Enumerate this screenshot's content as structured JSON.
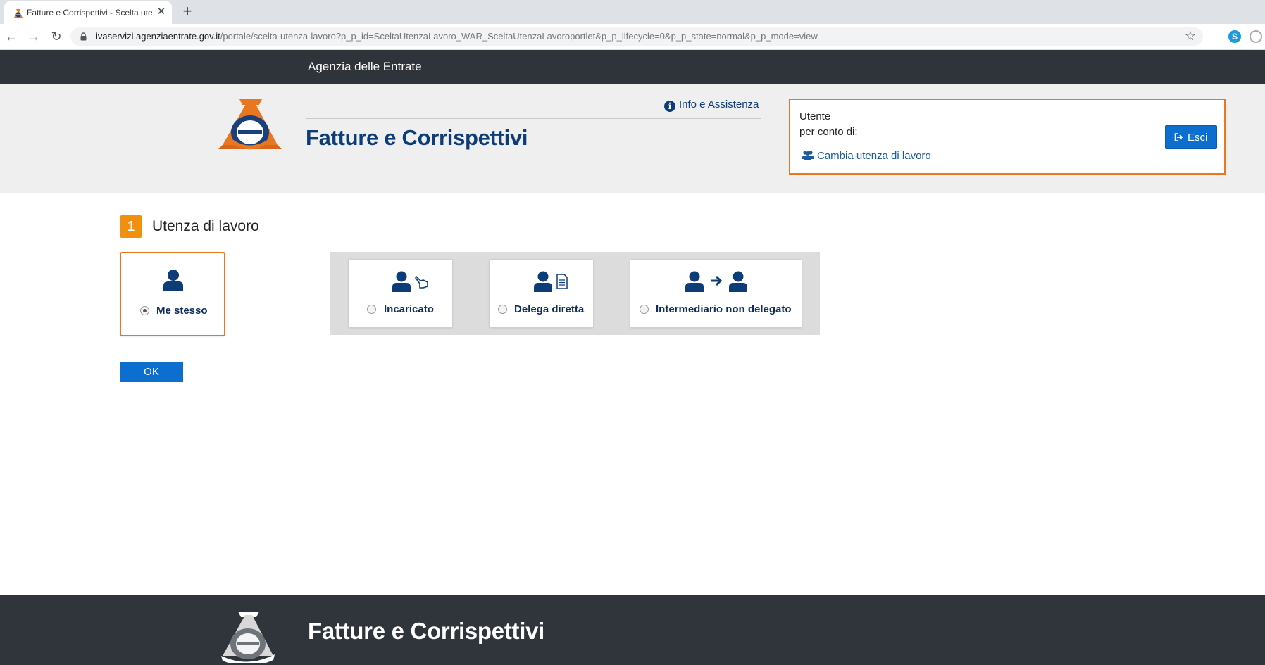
{
  "browser": {
    "tab_title": "Fatture e Corrispettivi - Scelta ute",
    "url_host": "ivaservizi.agenziaentrate.gov.it",
    "url_path": "/portale/scelta-utenza-lavoro?p_p_id=SceltaUtenzaLavoro_WAR_SceltaUtenzaLavoroportlet&p_p_lifecycle=0&p_p_state=normal&p_p_mode=view"
  },
  "site": {
    "agency_name": "Agenzia delle Entrate",
    "app_title": "Fatture e Corrispettivi",
    "info_link": "Info e Assistenza"
  },
  "user_box": {
    "user_label": "Utente",
    "per_conto_label": "per conto di:",
    "change_link": "Cambia utenza di lavoro",
    "logout_label": "Esci"
  },
  "step": {
    "number": "1",
    "title": "Utenza di lavoro"
  },
  "options": [
    {
      "label": "Me stesso",
      "selected": true
    },
    {
      "label": "Incaricato",
      "selected": false
    },
    {
      "label": "Delega diretta",
      "selected": false
    },
    {
      "label": "Intermediario non delegato",
      "selected": false
    }
  ],
  "ok_label": "OK",
  "footer": {
    "title": "Fatture e Corrispettivi"
  },
  "colors": {
    "brand_navy": "#0d3d79",
    "brand_orange": "#e87722",
    "button_blue": "#0c6fcf",
    "dark_bar": "#2f343b"
  }
}
